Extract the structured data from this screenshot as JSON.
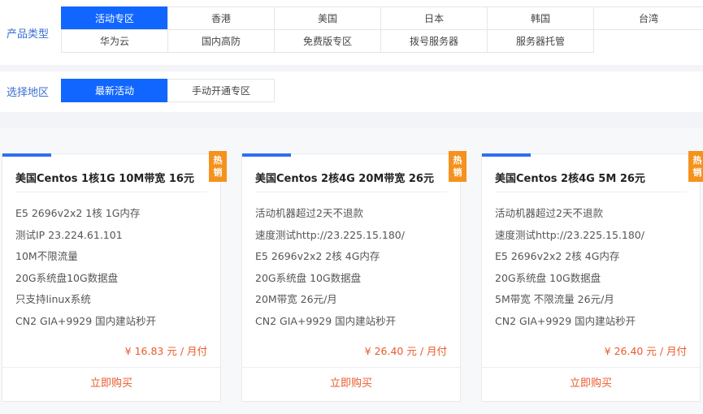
{
  "product_type": {
    "label": "产品类型",
    "tabs": [
      "活动专区",
      "香港",
      "美国",
      "日本",
      "韩国",
      "台湾",
      "华为云",
      "国内高防",
      "免费版专区",
      "拨号服务器",
      "服务器托管"
    ],
    "active_index": 0
  },
  "region": {
    "label": "选择地区",
    "tabs": [
      "最新活动",
      "手动开通专区"
    ],
    "active_index": 0
  },
  "colors": {
    "accent": "#1166ff",
    "hot_badge": "#f5921e",
    "price": "#ea5a2b"
  },
  "cards": [
    {
      "title": "美国Centos 1核1G 10M带宽 16元",
      "badge": "热销",
      "specs": [
        "E5 2696v2x2 1核 1G内存",
        "测试IP 23.224.61.101",
        "10M不限流量",
        "20G系统盘10G数据盘",
        "只支持linux系统",
        "CN2 GIA+9929 国内建站秒开"
      ],
      "price": "¥ 16.83 元 / 月付",
      "buy_label": "立即购买"
    },
    {
      "title": "美国Centos 2核4G 20M带宽 26元",
      "badge": "热销",
      "specs": [
        "活动机器超过2天不退款",
        "速度测试http://23.225.15.180/",
        "E5 2696v2x2 2核 4G内存",
        "20G系统盘 10G数据盘",
        "20M带宽 26元/月",
        "CN2 GIA+9929 国内建站秒开"
      ],
      "price": "¥ 26.40 元 / 月付",
      "buy_label": "立即购买"
    },
    {
      "title": "美国Centos 2核4G 5M 26元",
      "badge": "热销",
      "specs": [
        "活动机器超过2天不退款",
        "速度测试http://23.225.15.180/",
        "E5 2696v2x2 2核 4G内存",
        "20G系统盘 10G数据盘",
        "5M带宽 不限流量 26元/月",
        "CN2 GIA+9929 国内建站秒开"
      ],
      "price": "¥ 26.40 元 / 月付",
      "buy_label": "立即购买"
    }
  ]
}
